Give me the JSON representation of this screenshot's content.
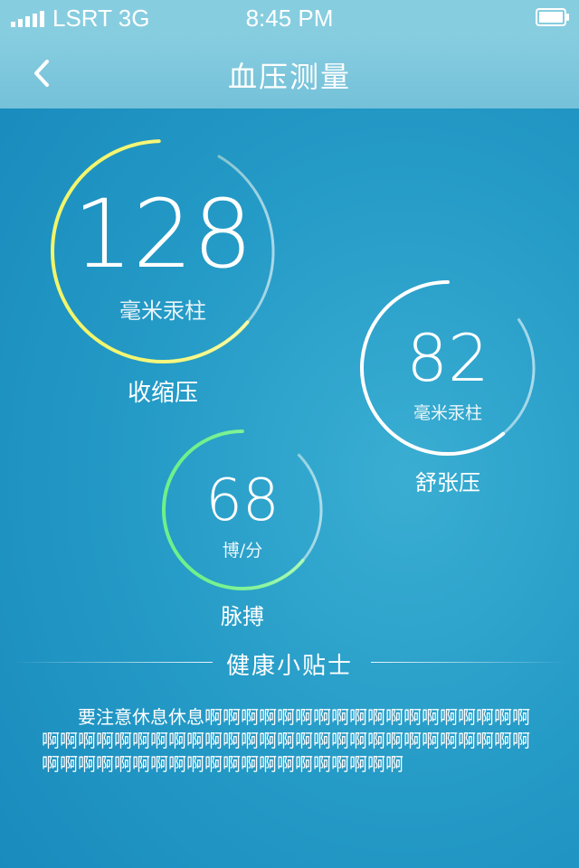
{
  "status_bar": {
    "carrier": "LSRT 3G",
    "time": "8:45 PM",
    "signal_icon": "signal-bars-icon",
    "battery_icon": "battery-icon"
  },
  "nav": {
    "back_icon": "chevron-left-icon",
    "title": "血压测量"
  },
  "gauges": {
    "systolic": {
      "value": "128",
      "unit": "毫米汞柱",
      "label": "收缩压",
      "color": "#f2f56a"
    },
    "diastolic": {
      "value": "82",
      "unit": "毫米汞柱",
      "label": "舒张压",
      "color": "#ffffff"
    },
    "pulse": {
      "value": "68",
      "unit": "博/分",
      "label": "脉搏",
      "color": "#6ef08a"
    }
  },
  "tips": {
    "title": "健康小贴士",
    "body": "要注意休息休息啊啊啊啊啊啊啊啊啊啊啊啊啊啊啊啊啊啊啊啊啊啊啊啊啊啊啊啊啊啊啊啊啊啊啊啊啊啊啊啊啊啊啊啊啊啊啊啊啊啊啊啊啊啊啊啊啊啊啊啊啊啊啊啊啊"
  },
  "colors": {
    "background": "#259bc7",
    "header": "#87cde0"
  }
}
